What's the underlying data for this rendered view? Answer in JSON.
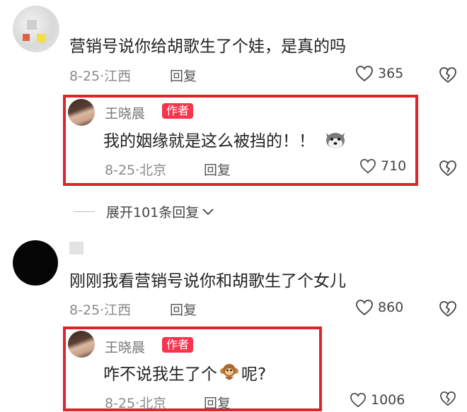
{
  "comment1": {
    "text": "营销号说你给胡歌生了个娃，是真的吗",
    "date": "8-25",
    "location": "江西",
    "reply_label": "回复",
    "likes": "365",
    "reply": {
      "author": "王晓晨",
      "badge": "作者",
      "text": "我的姻缘就是这么被挡的！！",
      "emoji": "husky-emoji",
      "date": "8-25",
      "location": "北京",
      "reply_label": "回复",
      "likes": "710"
    }
  },
  "expand": {
    "label": "展开101条回复"
  },
  "comment2": {
    "text": "刚刚我看营销号说你和胡歌生了个女儿",
    "date": "8-25",
    "location": "江西",
    "reply_label": "回复",
    "likes": "860",
    "reply": {
      "author": "王晓晨",
      "badge": "作者",
      "text_before": "咋不说我生了个",
      "emoji": "monkey-emoji",
      "text_after": "呢?",
      "date": "8-25",
      "location": "北京",
      "reply_label": "回复",
      "likes": "1006"
    }
  },
  "colors": {
    "highlight": "#e0232b",
    "badge": "#f7344e"
  }
}
